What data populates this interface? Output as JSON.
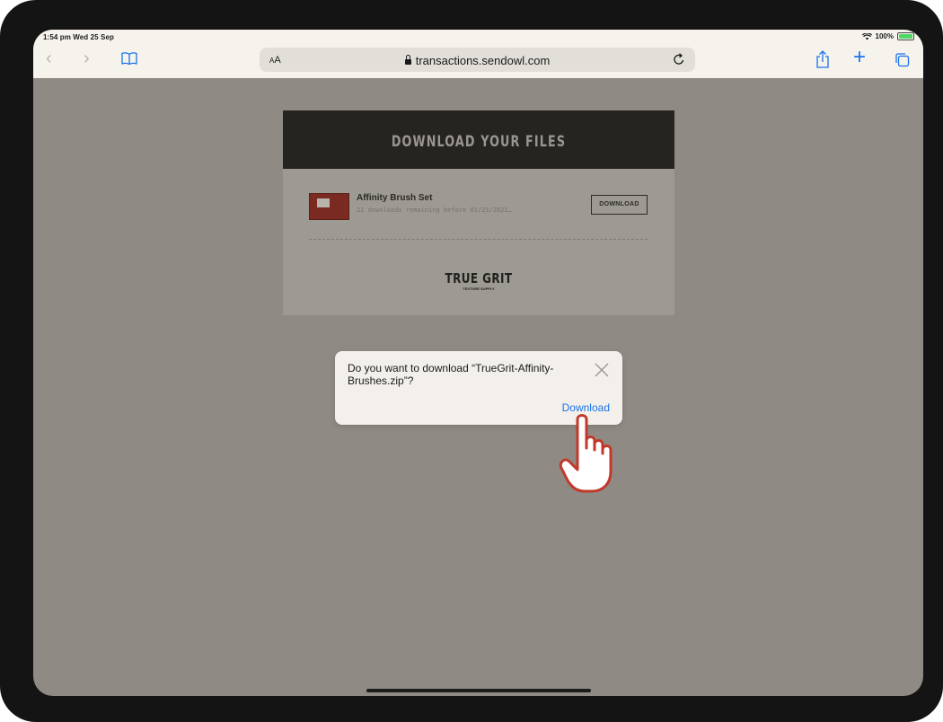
{
  "status_bar": {
    "time": "1:54 pm  Wed 25 Sep",
    "battery": "100%"
  },
  "browser": {
    "text_size_label_small": "A",
    "text_size_label_large": "A",
    "url": "transactions.sendowl.com",
    "icons": [
      "back-icon",
      "forward-icon",
      "bookmarks-icon",
      "lock-icon",
      "reload-icon",
      "share-icon",
      "new-tab-icon",
      "tabs-icon"
    ],
    "accent_color": "#1a73e8"
  },
  "page": {
    "title": "DOWNLOAD YOUR FILES",
    "product_name": "Affinity Brush Set",
    "product_subtitle": "21 downloads remaining before 01/23/2021…",
    "download_button": "DOWNLOAD",
    "logo_text": "TRUE GRIT",
    "logo_subtext": "TEXTURE SUPPLY"
  },
  "dialog": {
    "message": "Do you want to download “TrueGrit-Affinity-Brushes.zip”?",
    "action": "Download"
  }
}
